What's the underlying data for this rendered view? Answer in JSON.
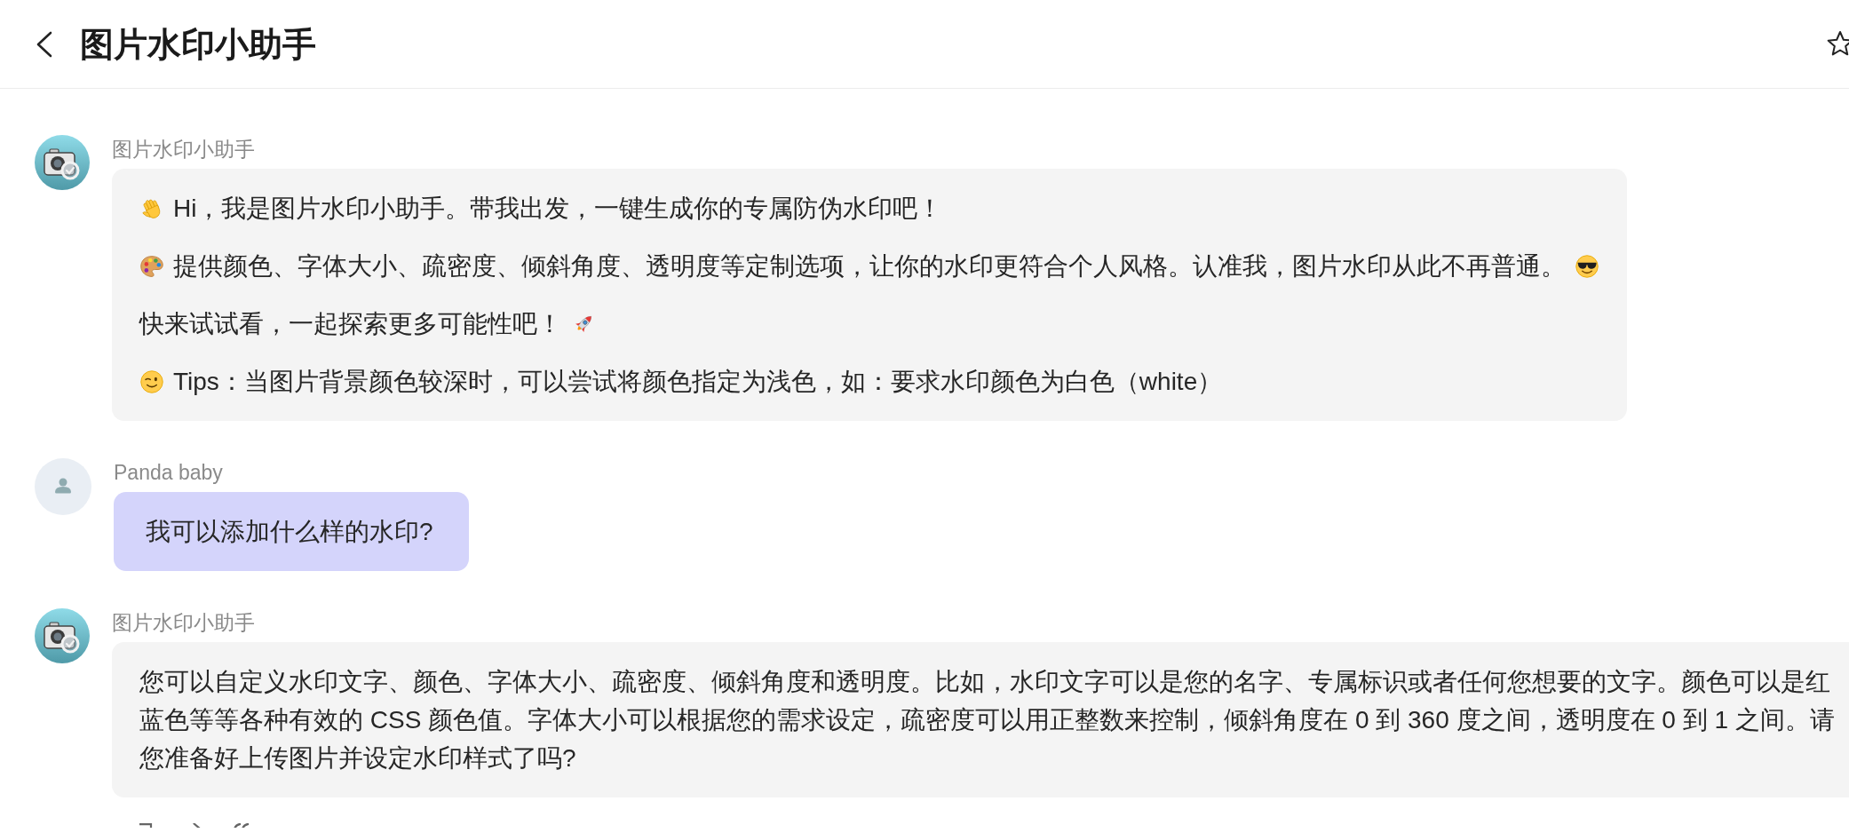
{
  "header": {
    "title": "图片水印小助手"
  },
  "messages": [
    {
      "kind": "assistant",
      "sender": "图片水印小助手",
      "cut_off": false,
      "actions_visible": false,
      "paragraphs": [
        {
          "kind": "greeting",
          "text": "Hi，我是图片水印小助手。带我出发，一键生成你的专属防伪水印吧！"
        },
        {
          "kind": "features",
          "text": "提供颜色、字体大小、疏密度、倾斜角度、透明度等定制选项，让你的水印更符合个人风格。认准我，图片水印从此不再普通。"
        },
        {
          "kind": "invite",
          "text": "快来试试看，一起探索更多可能性吧！"
        },
        {
          "kind": "tip",
          "text": "Tips：当图片背景颜色较深时，可以尝试将颜色指定为浅色，如：要求水印颜色为白色（white）"
        }
      ]
    },
    {
      "kind": "user",
      "sender": "Panda baby",
      "cut_off": false,
      "actions_visible": false,
      "paragraphs": [
        {
          "kind": "plain",
          "text": "我可以添加什么样的水印?"
        }
      ]
    },
    {
      "kind": "assistant",
      "sender": "图片水印小助手",
      "cut_off": true,
      "actions_visible": true,
      "paragraphs": [
        {
          "kind": "wrapped",
          "lines": [
            "您可以自定义水印文字、颜色、字体大小、疏密度、倾斜角度和透明度。比如，水印文字可以是您的名字、专属标识或者任何您想要的文字。颜色可以是红",
            "蓝色等等各种有效的 CSS 颜色值。字体大小可以根据您的需求设定，疏密度可以用正整数来控制，倾斜角度在 0 到 360 度之间，透明度在 0 到 1 之间。请",
            "您准备好上传图片并设定水印样式了吗?"
          ]
        }
      ]
    }
  ]
}
